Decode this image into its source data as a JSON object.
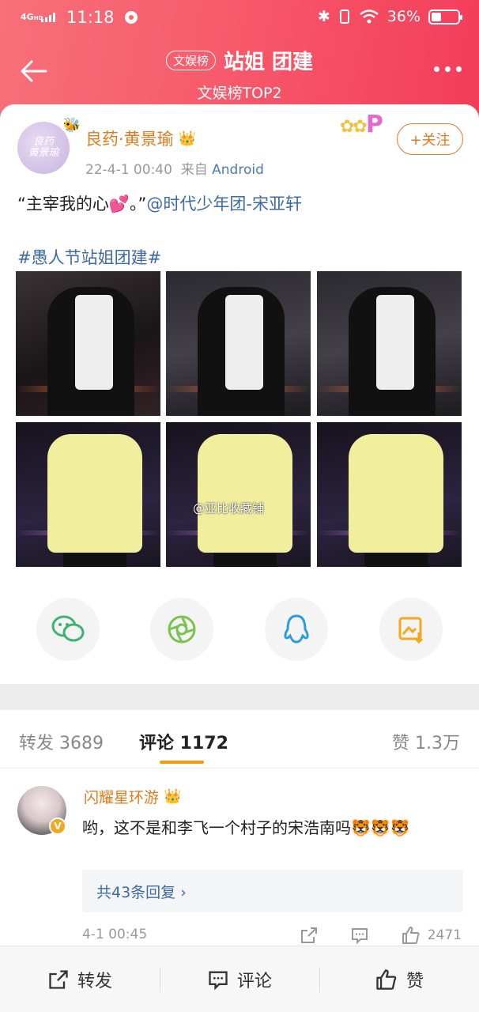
{
  "status_bar": {
    "network": "4G",
    "network_sub": "HD",
    "time": "11:18",
    "battery": "36%"
  },
  "nav": {
    "badge": "文娱榜",
    "title": "站姐 团建",
    "subtitle": "文娱榜TOP2"
  },
  "post": {
    "author": "良药·黄景瑜",
    "time": "22-4-1 00:40",
    "source_prefix": "来自",
    "source": "Android",
    "follow_label": "+关注",
    "text_quote": "“主宰我的心💕。”",
    "text_mention": "@时代少年团-宋亚轩",
    "hashtag": "#愚人节站姐团建#",
    "watermark": "@亚比收藏铺"
  },
  "share_buttons": [
    "wechat-icon",
    "moments-icon",
    "qq-icon",
    "save-image-icon"
  ],
  "tabs": {
    "repost": "转发 3689",
    "comments": "评论 1172",
    "likes": "赞 1.3万"
  },
  "comment": {
    "user": "闪耀星环游",
    "text": "哟，这不是和李飞一个村子的宋浩南吗🐯🐯🐯",
    "replies": "共43条回复 ›",
    "time": "4-1 00:45",
    "like_count": "2471"
  },
  "bottom_bar": {
    "repost": "转发",
    "comment": "评论",
    "like": "赞"
  },
  "colors": {
    "header_start": "#f7707a",
    "header_end": "#f33c5a",
    "username": "#e07b1c",
    "link": "#3c6aa8",
    "tab_underline": "#f39c12"
  }
}
